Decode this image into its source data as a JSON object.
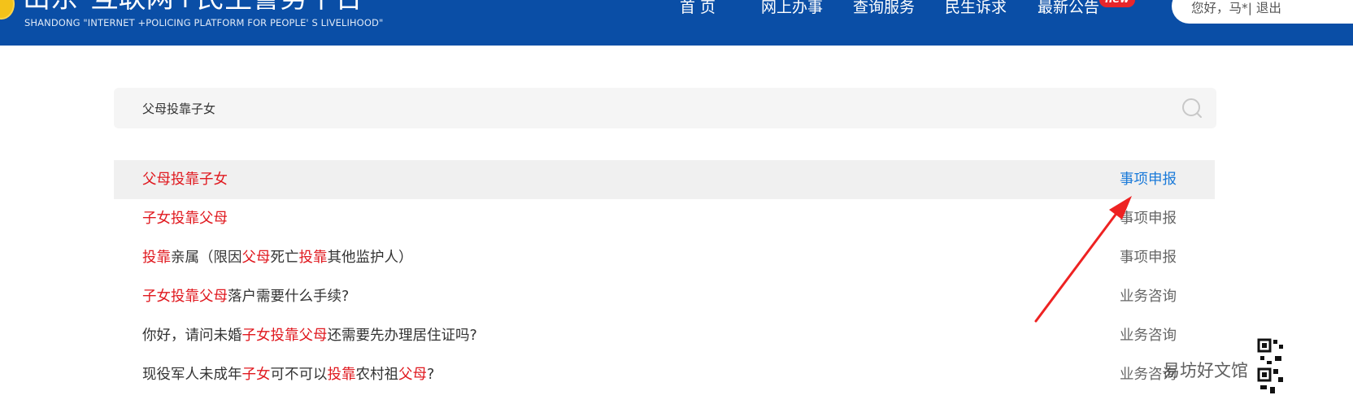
{
  "header": {
    "title": "山东\"互联网+民生警务平台\"",
    "subtitle": "SHANDONG  \"INTERNET +POLICING PLATFORM FOR PEOPLE'  S LIVELIHOOD\"",
    "nav": [
      {
        "label": "首 页"
      },
      {
        "label": "网上办事"
      },
      {
        "label": "查询服务"
      },
      {
        "label": "民生诉求"
      },
      {
        "label": "最新公告"
      }
    ],
    "new_badge": "new",
    "user_greeting": "您好，马*| 退出"
  },
  "search": {
    "value": "父母投靠子女",
    "placeholder": ""
  },
  "results": [
    {
      "parts": [
        {
          "text": "父母投靠子女",
          "hl": true
        }
      ],
      "type": "事项申报",
      "active": true
    },
    {
      "parts": [
        {
          "text": "子女投靠父母",
          "hl": true
        }
      ],
      "type": "事项申报",
      "active": false
    },
    {
      "parts": [
        {
          "text": "投靠",
          "hl": true
        },
        {
          "text": "亲属（限因",
          "hl": false
        },
        {
          "text": "父母",
          "hl": true
        },
        {
          "text": "死亡",
          "hl": false
        },
        {
          "text": "投靠",
          "hl": true
        },
        {
          "text": "其他监护人）",
          "hl": false
        }
      ],
      "type": "事项申报",
      "active": false
    },
    {
      "parts": [
        {
          "text": "子女投靠父母",
          "hl": true
        },
        {
          "text": "落户需要什么手续?",
          "hl": false
        }
      ],
      "type": "业务咨询",
      "active": false
    },
    {
      "parts": [
        {
          "text": "你好，请问未婚",
          "hl": false
        },
        {
          "text": "子女投靠父母",
          "hl": true
        },
        {
          "text": "还需要先办理居住证吗?",
          "hl": false
        }
      ],
      "type": "业务咨询",
      "active": false
    },
    {
      "parts": [
        {
          "text": "现役军人未成年",
          "hl": false
        },
        {
          "text": "子女",
          "hl": true
        },
        {
          "text": "可不可以",
          "hl": false
        },
        {
          "text": "投靠",
          "hl": true
        },
        {
          "text": "农村祖",
          "hl": false
        },
        {
          "text": "父母",
          "hl": true
        },
        {
          "text": "?",
          "hl": false
        }
      ],
      "type": "业务咨询",
      "active": false
    }
  ],
  "watermark": "易坊好文馆",
  "colors": {
    "header_bg": "#0a4ea6",
    "highlight": "#e0191f",
    "link_blue": "#1a7ad9",
    "annotation_red": "#ee2222"
  },
  "icons": {
    "emblem": "police-emblem-icon",
    "search": "search-icon",
    "annotation": "red-arrow-annotation-icon",
    "qr": "qr-code-icon"
  }
}
